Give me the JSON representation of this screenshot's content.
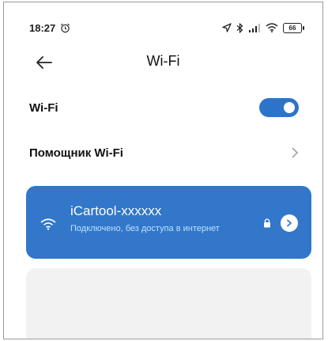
{
  "status_bar": {
    "time": "18:27",
    "battery": "66"
  },
  "header": {
    "title": "Wi-Fi"
  },
  "wifi_row": {
    "label": "Wi-Fi",
    "enabled": true
  },
  "assistant_row": {
    "label": "Помощник Wi-Fi"
  },
  "network": {
    "name": "iCartool-xxxxxx",
    "status": "Подключено, без доступа в интернет"
  },
  "colors": {
    "accent": "#3277c9",
    "status_text": "#bfe0ff"
  },
  "icons": {
    "back": "arrow-left-icon",
    "alarm": "alarm-icon",
    "location": "location-arrow-icon",
    "bluetooth": "bluetooth-icon",
    "signal": "signal-bars-icon",
    "wifi": "wifi-icon",
    "lock": "lock-icon",
    "chevron": "chevron-right-icon"
  }
}
